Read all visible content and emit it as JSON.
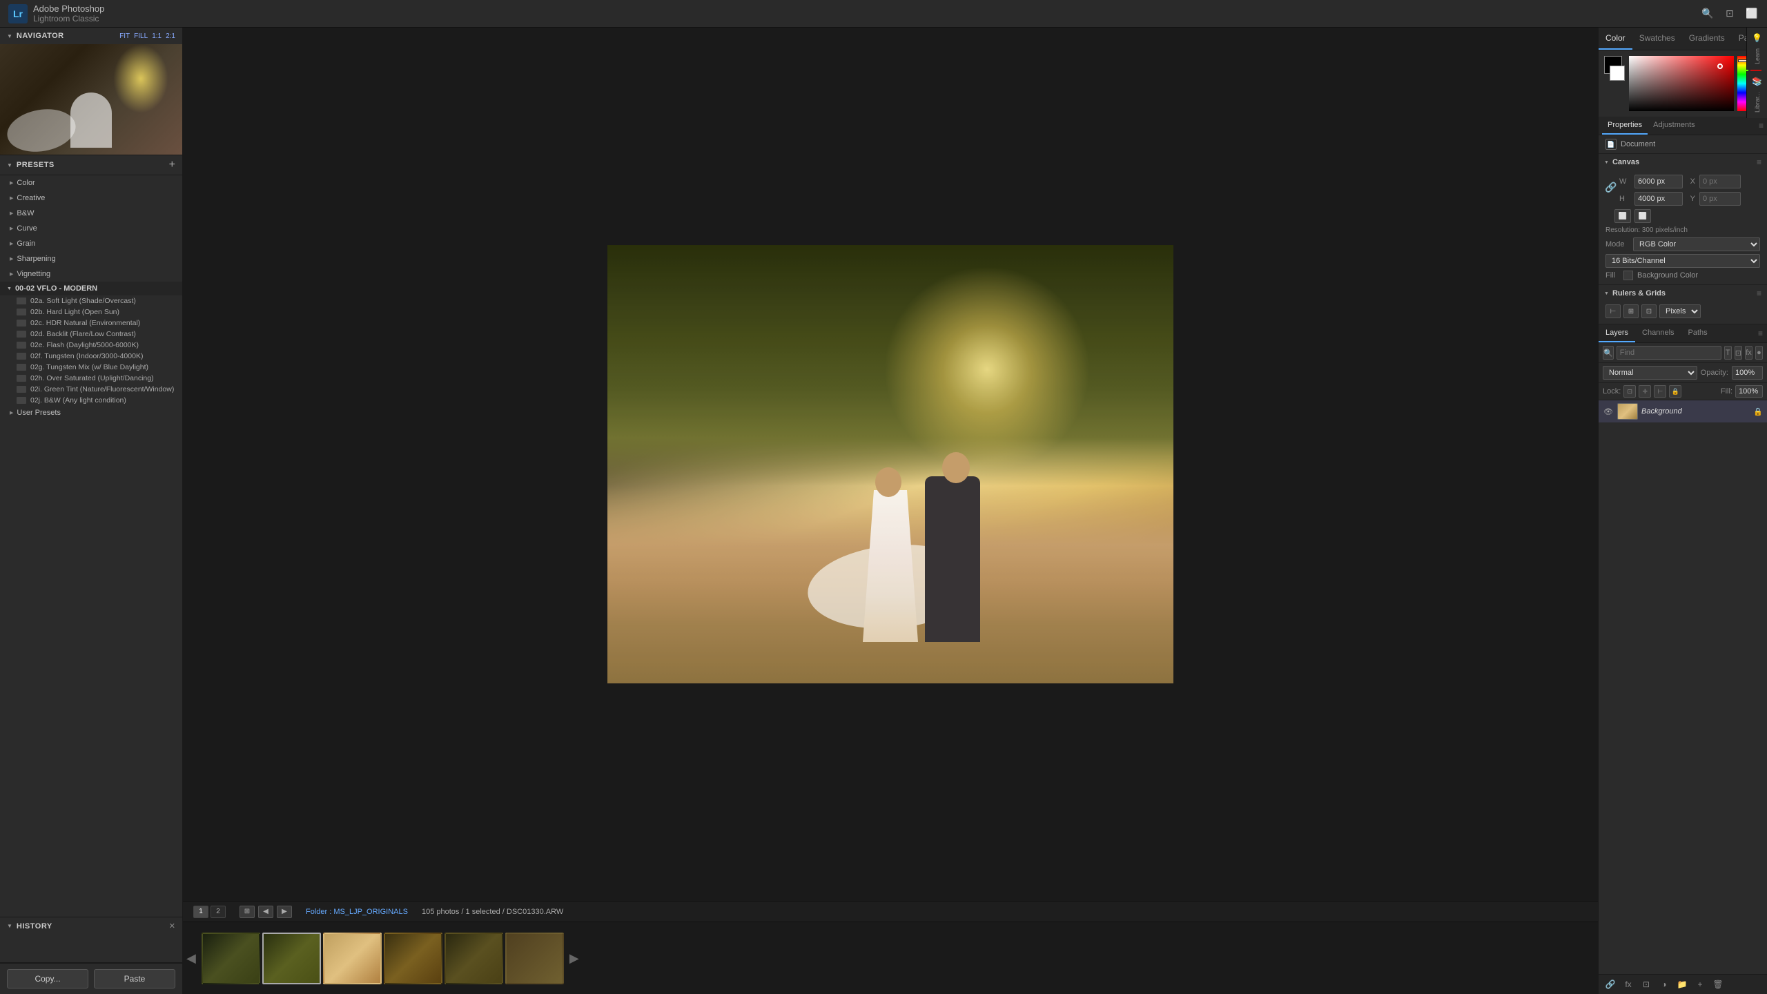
{
  "app": {
    "title": "Adobe Photoshop",
    "subtitle": "Lightroom Classic",
    "badge": "Lr"
  },
  "navigator": {
    "title": "Navigator",
    "zoom_fit": "FIT",
    "zoom_fill": "FILL",
    "zoom_1": "1:1",
    "zoom_2": "2:1"
  },
  "presets": {
    "title": "Presets",
    "add_label": "+",
    "groups": [
      {
        "label": "Color",
        "expanded": false
      },
      {
        "label": "Creative",
        "expanded": false
      },
      {
        "label": "B&W",
        "expanded": false
      },
      {
        "label": "Curve",
        "expanded": false
      },
      {
        "label": "Grain",
        "expanded": false
      },
      {
        "label": "Sharpening",
        "expanded": false
      },
      {
        "label": "Vignetting",
        "expanded": false
      }
    ],
    "vflo_group": "00-02 VFLO - MODERN",
    "vflo_items": [
      "02a. Soft Light (Shade/Overcast)",
      "02b. Hard Light (Open Sun)",
      "02c. HDR Natural (Environmental)",
      "02d. Backlit (Flare/Low Contrast)",
      "02e. Flash (Daylight/5000-6000K)",
      "02f. Tungsten (Indoor/3000-4000K)",
      "02g. Tungsten Mix (w/ Blue Daylight)",
      "02h. Over Saturated (Uplight/Dancing)",
      "02i. Green Tint (Nature/Fluorescent/Window)",
      "02j. B&W (Any light condition)"
    ],
    "user_presets": "User Presets"
  },
  "history": {
    "title": "History",
    "close_symbol": "✕"
  },
  "copy_paste": {
    "copy_label": "Copy...",
    "paste_label": "Paste"
  },
  "status": {
    "folder_label": "Folder : MS_LJP_ORIGINALS",
    "photos_count": "105 photos / 1 selected /",
    "file_name": "DSC01330.ARW",
    "view_btn1": "1",
    "view_btn2": "2",
    "nav_prev": "◀",
    "nav_next": "▶"
  },
  "right_panel": {
    "top_tabs": [
      "Color",
      "Swatches",
      "Gradients",
      "Patterns"
    ],
    "active_top_tab": "Color",
    "learn_label": "Learn",
    "libraries_label": "Librar...",
    "props_tabs": [
      "Properties",
      "Adjustments"
    ],
    "active_props_tab": "Properties",
    "document_label": "Document",
    "canvas": {
      "title": "Canvas",
      "width_label": "W",
      "width_value": "6000 px",
      "height_label": "H",
      "height_value": "4000 px",
      "x_label": "X",
      "x_value": "",
      "y_label": "Y",
      "y_value": "",
      "resolution": "Resolution: 300 pixels/inch",
      "mode_label": "Mode",
      "mode_value": "RGB Color",
      "bits_value": "16 Bits/Channel",
      "fill_label": "Fill",
      "bg_color_label": "Background Color"
    },
    "rulers": {
      "title": "Rulers & Grids",
      "units": "Pixels"
    },
    "layers": {
      "tabs": [
        "Layers",
        "Channels",
        "Paths"
      ],
      "active_tab": "Layers",
      "blend_mode": "Normal",
      "opacity_label": "Opacity:",
      "opacity_value": "100%",
      "lock_label": "Lock:",
      "fill_label": "Fill:",
      "fill_value": "100%",
      "background_layer": "Background"
    }
  }
}
